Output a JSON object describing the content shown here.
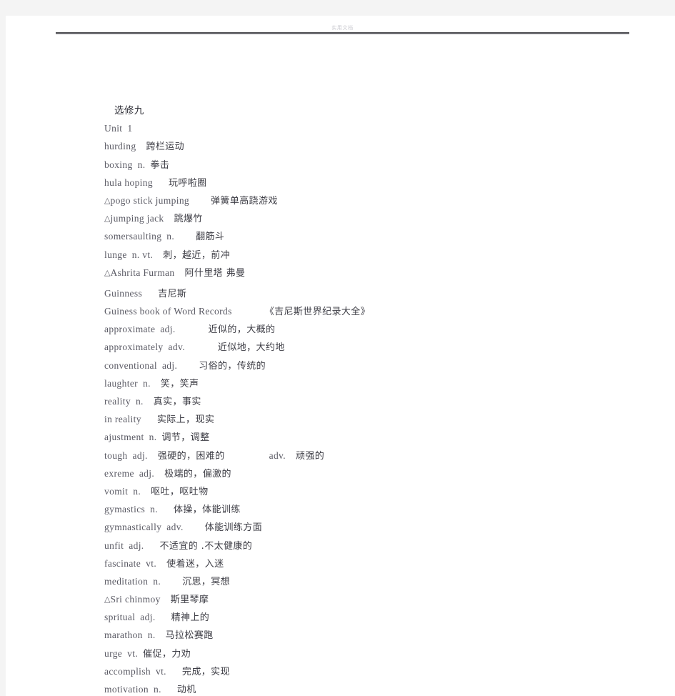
{
  "document": {
    "header_text": "实用文档",
    "title_line": "选修九"
  },
  "entries": [
    {
      "kind": "title",
      "mark": "",
      "en": "",
      "pos": "",
      "gap": "",
      "cn": "选修九"
    },
    {
      "kind": "head",
      "mark": "",
      "en": "Unit",
      "pos": "1",
      "gap": "sp-1",
      "cn": ""
    },
    {
      "kind": "entry",
      "mark": "",
      "en": "hurding",
      "pos": "",
      "gap": "sp-2",
      "cn": "跨栏运动"
    },
    {
      "kind": "entry",
      "mark": "",
      "en": "boxing",
      "pos": "n.",
      "gap": "sp-1",
      "cn": "拳击"
    },
    {
      "kind": "entry",
      "mark": "",
      "en": "hula hoping",
      "pos": "",
      "gap": "sp-3",
      "cn": "玩呼啦圈"
    },
    {
      "kind": "entry",
      "mark": "△",
      "en": "pogo stick jumping",
      "pos": "",
      "gap": "sp-4",
      "cn": "弹簧单高跷游戏"
    },
    {
      "kind": "entry",
      "mark": "△",
      "en": "jumping jack",
      "pos": "",
      "gap": "sp-2",
      "cn": "跳爆竹"
    },
    {
      "kind": "entry",
      "mark": "",
      "en": "somersaulting",
      "pos": "n.",
      "gap": "sp-4",
      "cn": "翻筋斗"
    },
    {
      "kind": "entry",
      "mark": "",
      "en": "lunge",
      "pos": "n. vt.",
      "gap": "sp-2",
      "cn": "刺，越近，前冲"
    },
    {
      "kind": "entry",
      "mark": "△",
      "en": "Ashrita Furman",
      "pos": "",
      "gap": "sp-2",
      "cn": "阿什里塔  弗曼"
    },
    {
      "kind": "spacer",
      "mark": "",
      "en": "",
      "pos": "",
      "gap": "",
      "cn": ""
    },
    {
      "kind": "entry",
      "mark": "",
      "en": "Guinness",
      "pos": "",
      "gap": "sp-3",
      "cn": "吉尼斯"
    },
    {
      "kind": "entry",
      "mark": "",
      "en": "Guiness book of Word Records",
      "pos": "",
      "gap": "sp-6",
      "cn": "《吉尼斯世界纪录大全》"
    },
    {
      "kind": "entry",
      "mark": "",
      "en": "approximate",
      "pos": "adj.",
      "gap": "sp-6",
      "cn": "近似的，大概的"
    },
    {
      "kind": "entry",
      "mark": "",
      "en": "approximately",
      "pos": "adv.",
      "gap": "sp-6",
      "cn": "近似地，大约地"
    },
    {
      "kind": "entry",
      "mark": "",
      "en": "conventional",
      "pos": "adj.",
      "gap": "sp-4",
      "cn": "习俗的，传统的"
    },
    {
      "kind": "entry",
      "mark": "",
      "en": "laughter",
      "pos": "n.",
      "gap": "sp-2",
      "cn": "笑，笑声"
    },
    {
      "kind": "entry",
      "mark": "",
      "en": "reality",
      "pos": "n.",
      "gap": "sp-2",
      "cn": "真实，事实"
    },
    {
      "kind": "entry",
      "mark": "",
      "en": "in reality",
      "pos": "",
      "gap": "sp-3",
      "cn": "实际上，现实"
    },
    {
      "kind": "entry",
      "mark": "",
      "en": "ajustment",
      "pos": "n.",
      "gap": "sp-1",
      "cn": "调节，调整"
    },
    {
      "kind": "entry",
      "mark": "",
      "en": "tough",
      "pos": "adj.",
      "gap": "sp-2",
      "cn": "强硬的，困难的",
      "extra_pos": "adv.",
      "extra_cn": "顽强的"
    },
    {
      "kind": "entry",
      "mark": "",
      "en": "exreme",
      "pos": "adj.",
      "gap": "sp-2",
      "cn": "极端的，偏激的"
    },
    {
      "kind": "entry",
      "mark": "",
      "en": "vomit",
      "pos": "n.",
      "gap": "sp-2",
      "cn": "呕吐，呕吐物"
    },
    {
      "kind": "entry",
      "mark": "",
      "en": "gymastics",
      "pos": "n.",
      "gap": "sp-3",
      "cn": "体操，体能训练"
    },
    {
      "kind": "entry",
      "mark": "",
      "en": "gymnastically",
      "pos": "adv.",
      "gap": "sp-4",
      "cn": "体能训练方面"
    },
    {
      "kind": "entry",
      "mark": "",
      "en": "unfit",
      "pos": "adj.",
      "gap": "sp-3",
      "cn": "不适宜的  .不太健康的"
    },
    {
      "kind": "entry",
      "mark": "",
      "en": "fascinate",
      "pos": "vt.",
      "gap": "sp-2",
      "cn": "使着迷，入迷"
    },
    {
      "kind": "entry",
      "mark": "",
      "en": "meditation",
      "pos": "n.",
      "gap": "sp-4",
      "cn": "沉思，冥想"
    },
    {
      "kind": "entry",
      "mark": "△",
      "en": "Sri chinmoy",
      "pos": "",
      "gap": "sp-2",
      "cn": "斯里琴摩"
    },
    {
      "kind": "entry",
      "mark": "",
      "en": "spritual",
      "pos": "adj.",
      "gap": "sp-3",
      "cn": "精神上的"
    },
    {
      "kind": "entry",
      "mark": "",
      "en": "marathon",
      "pos": "n.",
      "gap": "sp-2",
      "cn": "马拉松赛跑"
    },
    {
      "kind": "entry",
      "mark": "",
      "en": "urge",
      "pos": "vt.",
      "gap": "sp-1",
      "cn": "催促，力劝"
    },
    {
      "kind": "entry",
      "mark": "",
      "en": "accomplish",
      "pos": "vt.",
      "gap": "sp-3",
      "cn": "完成，实现"
    },
    {
      "kind": "entry",
      "mark": "",
      "en": "motivation",
      "pos": "n.",
      "gap": "sp-3",
      "cn": "动机"
    }
  ],
  "colors": {
    "page_background": "#ffffff",
    "viewport_background": "#f4f4f4",
    "english_text": "#5a5a64",
    "chinese_text": "#3c3c44",
    "rule": "#555559",
    "header_text": "#c9c9cf"
  }
}
